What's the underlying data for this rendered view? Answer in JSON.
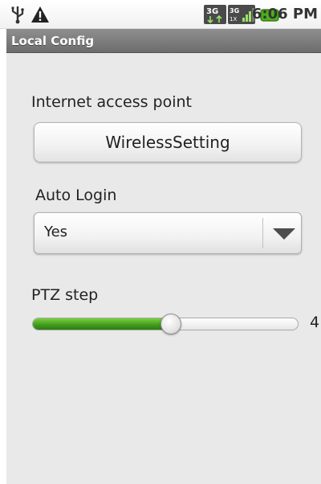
{
  "status_bar": {
    "time": "6:06 PM",
    "icons": [
      "usb-icon",
      "warning-icon",
      "network-3g-icon",
      "signal-icon",
      "battery-icon"
    ],
    "battery_color": "#4caf1a"
  },
  "title_bar": {
    "title": "Local Config"
  },
  "form": {
    "access_point_label": "Internet access point",
    "access_point_value": "WirelessSetting",
    "auto_login_label": "Auto Login",
    "auto_login_value": "Yes",
    "ptz_step_label": "PTZ step",
    "ptz_step_value": "4",
    "ptz_step_fraction": 0.52,
    "accent_color": "#4caf1a"
  }
}
